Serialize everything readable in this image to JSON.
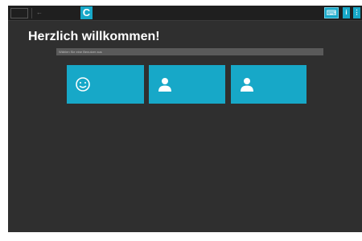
{
  "welcome_title": "Herzlich willkommen!",
  "hint_text": "Wählen Sie eine Benutzer aus",
  "colors": {
    "accent": "#17a8c8",
    "background": "#2f2f2f",
    "topbar": "#1f1f1f"
  },
  "topbar": {
    "brand_letter": "C",
    "back_icon": "arrow-left-icon",
    "keyboard_icon": "keyboard-icon",
    "info_label": "i",
    "more_label": "⋮"
  },
  "tiles": [
    {
      "icon": "smiley-icon"
    },
    {
      "icon": "user-icon"
    },
    {
      "icon": "user-icon"
    }
  ]
}
